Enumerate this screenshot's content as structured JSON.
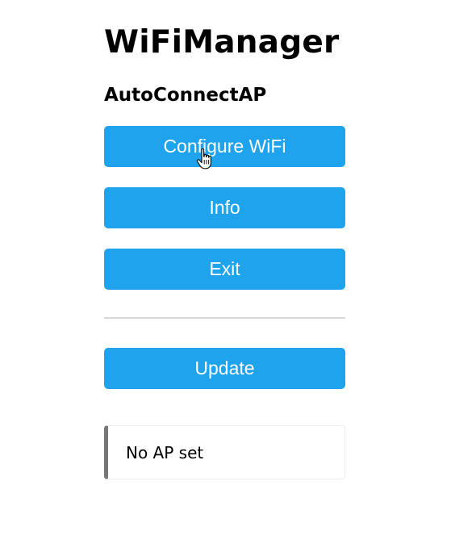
{
  "header": {
    "title": "WiFiManager",
    "subtitle": "AutoConnectAP"
  },
  "menu": {
    "configure_wifi_label": "Configure WiFi",
    "info_label": "Info",
    "exit_label": "Exit",
    "update_label": "Update"
  },
  "status": {
    "message": "No AP set"
  },
  "colors": {
    "button_background": "#1fa3ec",
    "button_text": "#ffffff",
    "message_border": "#777777"
  },
  "icons": {
    "cursor": "hand-pointer-icon"
  }
}
